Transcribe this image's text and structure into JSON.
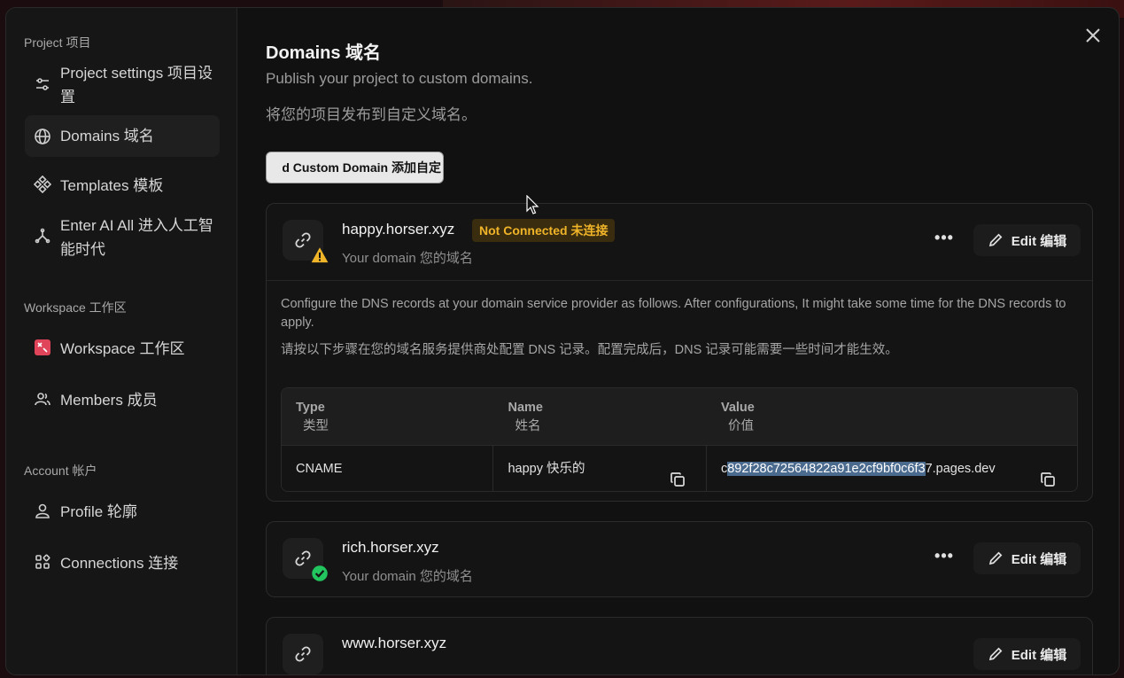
{
  "sidebar": {
    "project_section": "Project  项目",
    "workspace_section": "Workspace  工作区",
    "account_section": "Account  帐户",
    "items": [
      {
        "label": "Project settings  项目设置",
        "icon": "sliders-icon"
      },
      {
        "label": "Domains  域名",
        "icon": "globe-icon"
      },
      {
        "label": "Templates  模板",
        "icon": "templates-icon"
      },
      {
        "label": "Enter AI All  进入人工智能时代",
        "icon": "ai-icon"
      },
      {
        "label": "Workspace  工作区",
        "icon": "workspace-logo-icon"
      },
      {
        "label": "Members  成员",
        "icon": "members-icon"
      },
      {
        "label": "Profile  轮廓",
        "icon": "user-icon"
      },
      {
        "label": "Connections  连接",
        "icon": "connections-icon"
      }
    ]
  },
  "header": {
    "title": "Domains  域名",
    "subtitle_en": "Publish your project to custom domains.",
    "subtitle_zh": "将您的项目发布到自定义域名。",
    "add_button": "d Custom Domain  添加自定"
  },
  "domains": [
    {
      "name": "happy.horser.xyz",
      "status": "Not Connected  未连接",
      "sub": "Your domain    您的域名",
      "edit_label": "Edit  编辑",
      "dns_desc_en": "Configure the DNS records at your domain service provider as follows. After configurations, It might take some time for the DNS records to apply.",
      "dns_desc_zh": "请按以下步骤在您的域名服务提供商处配置 DNS 记录。配置完成后，DNS 记录可能需要一些时间才能生效。",
      "table_headers": [
        {
          "en": "Type",
          "zh": "类型"
        },
        {
          "en": "Name",
          "zh": "姓名"
        },
        {
          "en": "Value",
          "zh": "价值"
        }
      ],
      "record": {
        "type": "CNAME",
        "name": "happy  快乐的",
        "value_prefix": "c",
        "value_selected": "892f28c72564822a91e2cf9bf0c6f3",
        "value_suffix": "7.pages.dev"
      }
    },
    {
      "name": "rich.horser.xyz",
      "sub": "Your domain    您的域名",
      "edit_label": "Edit  编辑"
    },
    {
      "name": "www.horser.xyz",
      "edit_label": "Edit  编辑"
    }
  ],
  "colors": {
    "warning": "#f0b429",
    "success": "#22c55e",
    "selection": "#4a6a8e"
  }
}
